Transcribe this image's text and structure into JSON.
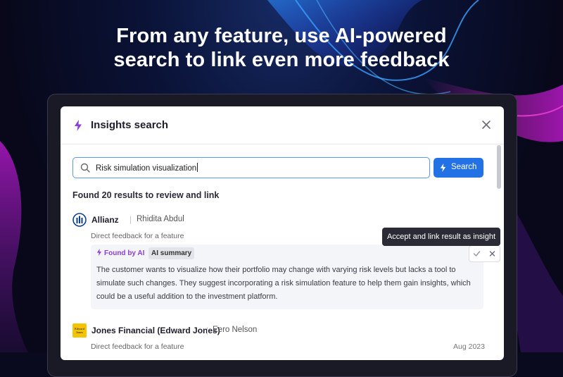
{
  "headline": {
    "line1": "From any feature, use AI-powered",
    "line2": "search to link even more feedback"
  },
  "modal": {
    "title": "Insights search",
    "search": {
      "value": "Risk simulation visualization",
      "button_label": "Search"
    },
    "results_count_text": "Found 20 results to review and link",
    "results": [
      {
        "company": "Allianz",
        "person": "Rhidita Abdul",
        "feedback_type": "Direct feedback for a feature",
        "found_by": "Found by AI",
        "summary_label": "AI summary",
        "summary": "The customer wants to visualize how their portfolio may change with varying risk levels but lacks a tool to simulate such changes. They suggest incorporating a risk simulation feature to help them gain insights, which could be a useful addition to the investment platform."
      },
      {
        "company": "Jones Financial (Edward Jones)",
        "person": "Eero Nelson",
        "feedback_type": "Direct feedback for a feature",
        "date": "Aug 2023",
        "logo_text": "Edward Jones"
      }
    ],
    "tooltip": "Accept and link result as insight"
  },
  "colors": {
    "accent_purple": "#8b3fd9",
    "button_blue": "#2272e6",
    "allianz_blue": "#0c3e8c",
    "edward_jones_yellow": "#f4c400"
  }
}
